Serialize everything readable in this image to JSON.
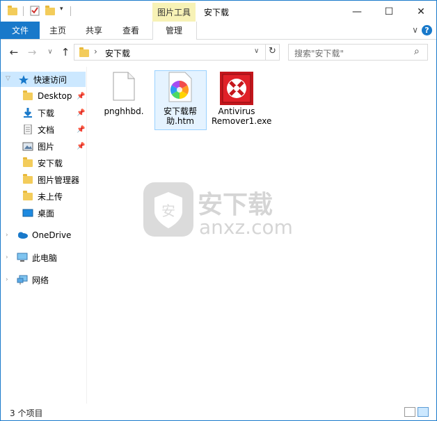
{
  "window": {
    "context_tab_title": "图片工具",
    "title": "安下载",
    "minimize_glyph": "—",
    "maximize_glyph": "☐",
    "close_glyph": "✕"
  },
  "ribbon": {
    "tabs": [
      "文件",
      "主页",
      "共享",
      "查看",
      "管理"
    ],
    "help_glyph": "?",
    "collapse_glyph": "∨"
  },
  "address": {
    "back_glyph": "←",
    "forward_glyph": "→",
    "recent_glyph": "∨",
    "up_glyph": "↑",
    "path_separator": "›",
    "path": "安下载",
    "dropdown_glyph": "∨",
    "refresh_glyph": "↻",
    "search_placeholder": "搜索\"安下载\"",
    "search_glyph": "⌕"
  },
  "nav_pane": {
    "quick_access": "快速访问",
    "quick_items": [
      "Desktop",
      "下载",
      "文档",
      "图片",
      "安下载",
      "图片管理器",
      "未上传",
      "桌面"
    ],
    "onedrive": "OneDrive",
    "this_pc": "此电脑",
    "network": "网络"
  },
  "files": [
    {
      "name": "pnghhbd.",
      "icon": "blank-file-icon"
    },
    {
      "name": "安下载帮助.htm",
      "icon": "htm-file-icon"
    },
    {
      "name": "Antivirus Remover1.exe",
      "icon": "antivirus-exe-icon"
    }
  ],
  "status": {
    "item_count": "3 个项目"
  },
  "colors": {
    "accent": "#1979ca",
    "context_tab": "#f7f2b6",
    "selection": "#cce8ff",
    "folder": "#f3cc5b"
  }
}
